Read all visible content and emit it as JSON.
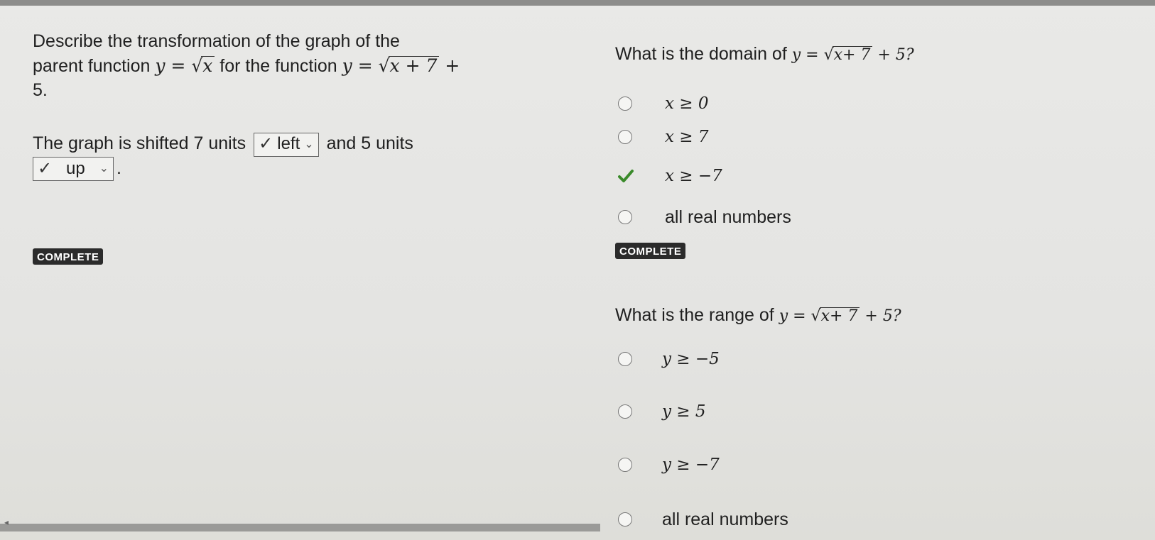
{
  "q1": {
    "line1": "Describe the transformation of the graph of the",
    "line2_pre": "parent function ",
    "parent_y": "y = ",
    "parent_rad": "x",
    "line2_mid": " for the function ",
    "fn_y": "y = ",
    "fn_rad": "x + 7",
    "fn_tail": " +",
    "line3": "5.",
    "answer_pre": "The graph is shifted 7 units",
    "dd1_value": "left",
    "answer_mid": "and 5 units",
    "dd2_value": "up",
    "answer_end": ".",
    "badge": "COMPLETE"
  },
  "q2": {
    "prompt": "What is the domain of ",
    "fn_y": "y = ",
    "fn_rad": "x+ 7",
    "fn_tail": " + 5?",
    "options": [
      "x ≥ 0",
      "x ≥ 7",
      "x ≥ −7",
      "all real numbers"
    ],
    "selected_index": 2,
    "badge": "COMPLETE"
  },
  "q3": {
    "prompt": "What is the range of ",
    "fn_y": "y = ",
    "fn_rad": "x+ 7",
    "fn_tail": " + 5?",
    "options": [
      "y ≥ −5",
      "y ≥ 5",
      "y ≥ −7",
      "all real numbers"
    ]
  },
  "icons": {
    "dropdown": "chevron-down-icon",
    "correct": "checkmark-icon",
    "radio": "radio-button-icon"
  },
  "colors": {
    "check_green": "#3a8a2a",
    "badge_bg": "#2b2b2b"
  }
}
